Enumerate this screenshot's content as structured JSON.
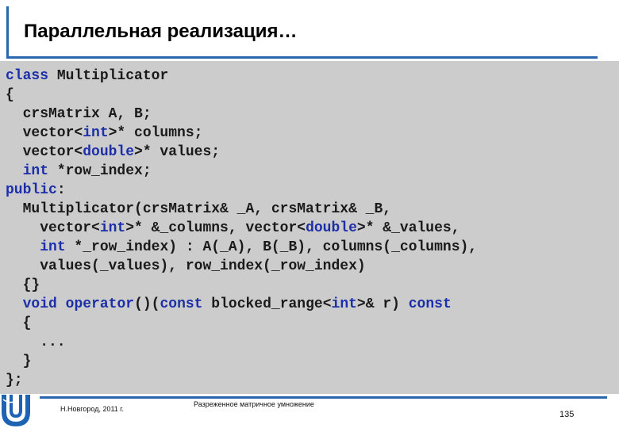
{
  "slide": {
    "title": "Параллельная реализация…",
    "footer_left": "Н.Новгород, 2011 г.",
    "footer_center": "Разреженное матричное умножение",
    "page_number": "135",
    "accent_color": "#2a66ad",
    "code_background": "#cccccc",
    "keyword_color": "#1c2fa8",
    "logo_icon": "university-logo-icon"
  },
  "code": {
    "language": "cpp",
    "lines": [
      [
        {
          "t": "class",
          "k": true
        },
        {
          "t": " Multiplicator"
        }
      ],
      [
        {
          "t": "{"
        }
      ],
      [
        {
          "t": "  crsMatrix A, B;"
        }
      ],
      [
        {
          "t": "  vector<"
        },
        {
          "t": "int",
          "k": true
        },
        {
          "t": ">* columns;"
        }
      ],
      [
        {
          "t": "  vector<"
        },
        {
          "t": "double",
          "k": true
        },
        {
          "t": ">* values;"
        }
      ],
      [
        {
          "t": "  "
        },
        {
          "t": "int",
          "k": true
        },
        {
          "t": " *row_index;"
        }
      ],
      [
        {
          "t": "public",
          "k": true
        },
        {
          "t": ":"
        }
      ],
      [
        {
          "t": "  Multiplicator(crsMatrix& _A, crsMatrix& _B,"
        }
      ],
      [
        {
          "t": "    vector<"
        },
        {
          "t": "int",
          "k": true
        },
        {
          "t": ">* &_columns, vector<"
        },
        {
          "t": "double",
          "k": true
        },
        {
          "t": ">* &_values,"
        }
      ],
      [
        {
          "t": "    "
        },
        {
          "t": "int",
          "k": true
        },
        {
          "t": " *_row_index) : A(_A), B(_B), columns(_columns),"
        }
      ],
      [
        {
          "t": "    values(_values), row_index(_row_index)"
        }
      ],
      [
        {
          "t": "  {}"
        }
      ],
      [
        {
          "t": "  "
        },
        {
          "t": "void",
          "k": true
        },
        {
          "t": " "
        },
        {
          "t": "operator",
          "k": true
        },
        {
          "t": "()("
        },
        {
          "t": "const",
          "k": true
        },
        {
          "t": " blocked_range<"
        },
        {
          "t": "int",
          "k": true
        },
        {
          "t": ">& r) "
        },
        {
          "t": "const",
          "k": true
        }
      ],
      [
        {
          "t": "  {"
        }
      ],
      [
        {
          "t": "    ..."
        }
      ],
      [
        {
          "t": "  }"
        }
      ],
      [
        {
          "t": "};"
        }
      ]
    ]
  }
}
